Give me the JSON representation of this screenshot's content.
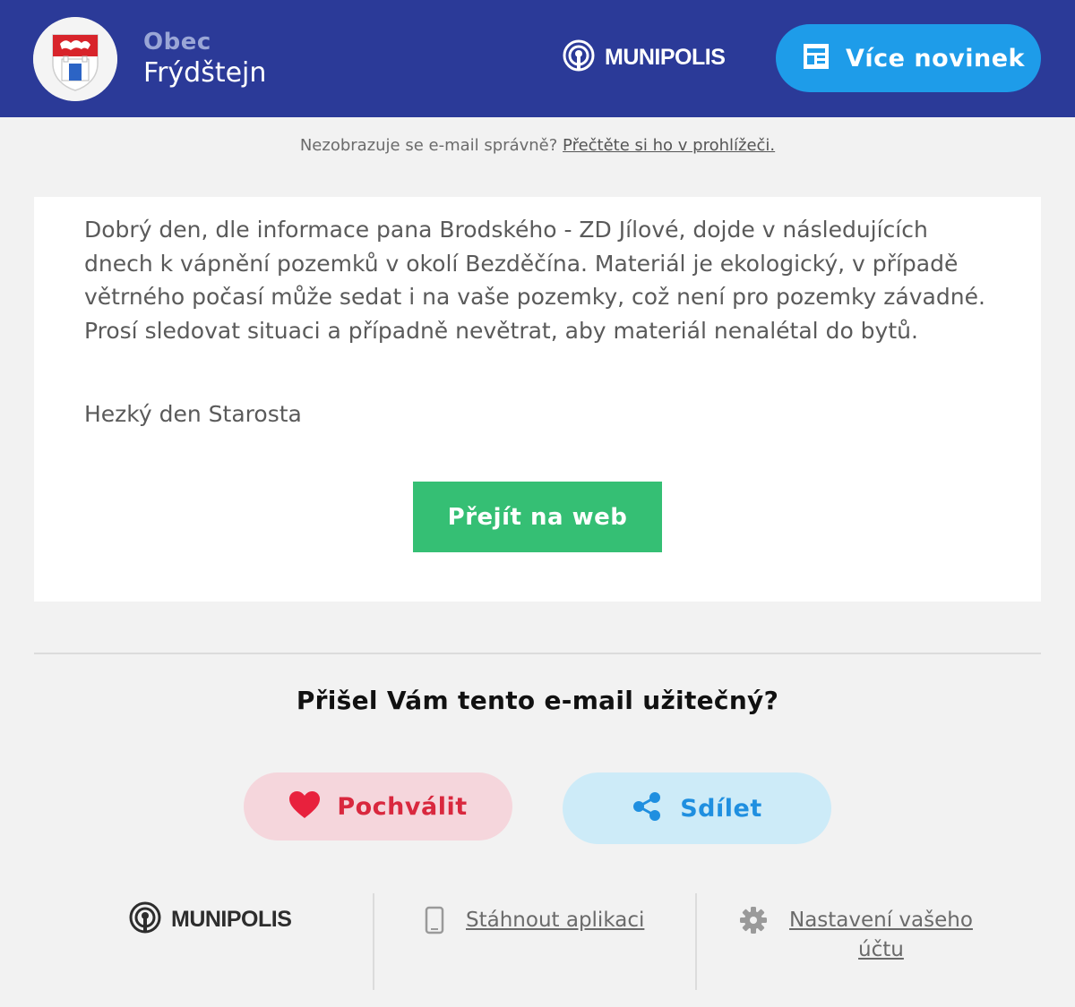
{
  "header": {
    "municipality_label": "Obec",
    "municipality_name": "Frýdštejn",
    "brand": "MUNIPOLIS",
    "more_news_label": "Více novinek"
  },
  "preheader": {
    "text": "Nezobrazuje se e-mail správně?",
    "link": "Přečtěte si ho v prohlížeči."
  },
  "message": {
    "body": "Dobrý den, dle informace pana Brodského - ZD Jílové, dojde v následujících dnech k vápnění pozemků v okolí Bezděčína. Materiál je ekologický, v případě větrného počasí může sedat i na vaše pozemky, což není pro pozemky závadné. Prosí sledovat situaci a případně nevětrat, aby materiál nenalétal do bytů.",
    "signature": "Hezký den Starosta",
    "button_label": "Přejít na web"
  },
  "feedback": {
    "question": "Přišel Vám tento e-mail užitečný?",
    "praise_label": "Pochválit",
    "share_label": "Sdílet"
  },
  "footer": {
    "brand": "MUNIPOLIS",
    "download_app": "Stáhnout aplikaci",
    "settings_line1": "Nastavení vašeho",
    "settings_line2": "účtu"
  },
  "colors": {
    "header_bg": "#2b3a98",
    "more_news_bg": "#1e9ce9",
    "web_button_bg": "#35bf74",
    "praise_bg": "#f5d6dc",
    "praise_fg": "#d9283e",
    "share_bg": "#cdebf8",
    "share_fg": "#1f8fe0"
  },
  "icons": {
    "brand": "broadcast-icon",
    "more_news": "newspaper-icon",
    "praise": "heart-icon",
    "share": "share-icon",
    "download": "smartphone-icon",
    "settings": "gear-icon"
  }
}
